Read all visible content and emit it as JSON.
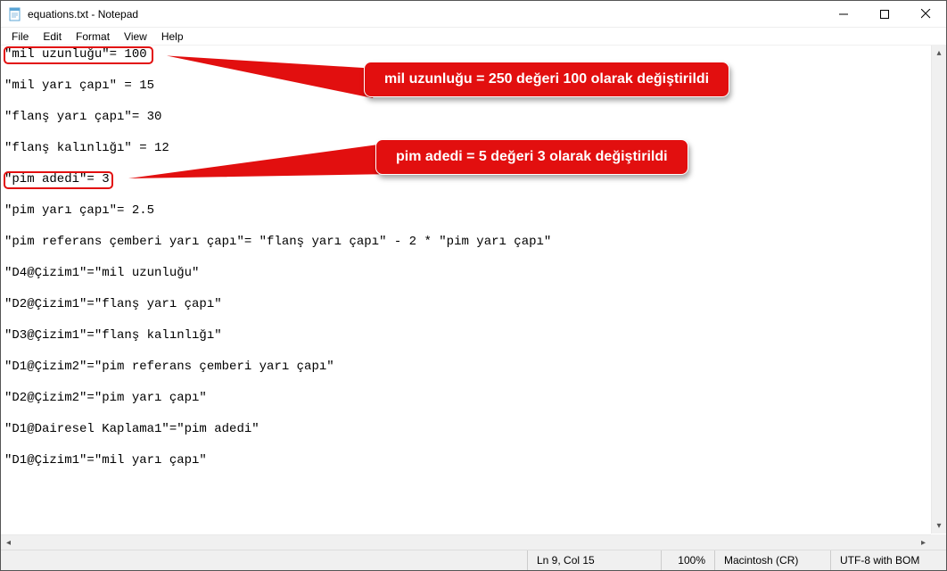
{
  "window": {
    "title": "equations.txt - Notepad"
  },
  "menu": {
    "file": "File",
    "edit": "Edit",
    "format": "Format",
    "view": "View",
    "help": "Help"
  },
  "editor": {
    "lines": [
      "\"mil uzunluğu\"= 100",
      "",
      "\"mil yarı çapı\" = 15",
      "",
      "\"flanş yarı çapı\"= 30",
      "",
      "\"flanş kalınlığı\" = 12",
      "",
      "\"pim adedi\"= 3",
      "",
      "\"pim yarı çapı\"= 2.5",
      "",
      "\"pim referans çemberi yarı çapı\"= \"flanş yarı çapı\" - 2 * \"pim yarı çapı\"",
      "",
      "\"D4@Çizim1\"=\"mil uzunluğu\"",
      "",
      "\"D2@Çizim1\"=\"flanş yarı çapı\"",
      "",
      "\"D3@Çizim1\"=\"flanş kalınlığı\"",
      "",
      "\"D1@Çizim2\"=\"pim referans çemberi yarı çapı\"",
      "",
      "\"D2@Çizim2\"=\"pim yarı çapı\"",
      "",
      "\"D1@Dairesel Kaplama1\"=\"pim adedi\"",
      "",
      "\"D1@Çizim1\"=\"mil yarı çapı\"",
      ""
    ]
  },
  "callout1": {
    "text": "mil uzunluğu = 250 değeri 100 olarak değiştirildi"
  },
  "callout2": {
    "text": "pim adedi = 5 değeri 3 olarak değiştirildi"
  },
  "statusbar": {
    "position": "Ln 9, Col 15",
    "zoom": "100%",
    "line_ending": "Macintosh (CR)",
    "encoding": "UTF-8 with BOM"
  }
}
